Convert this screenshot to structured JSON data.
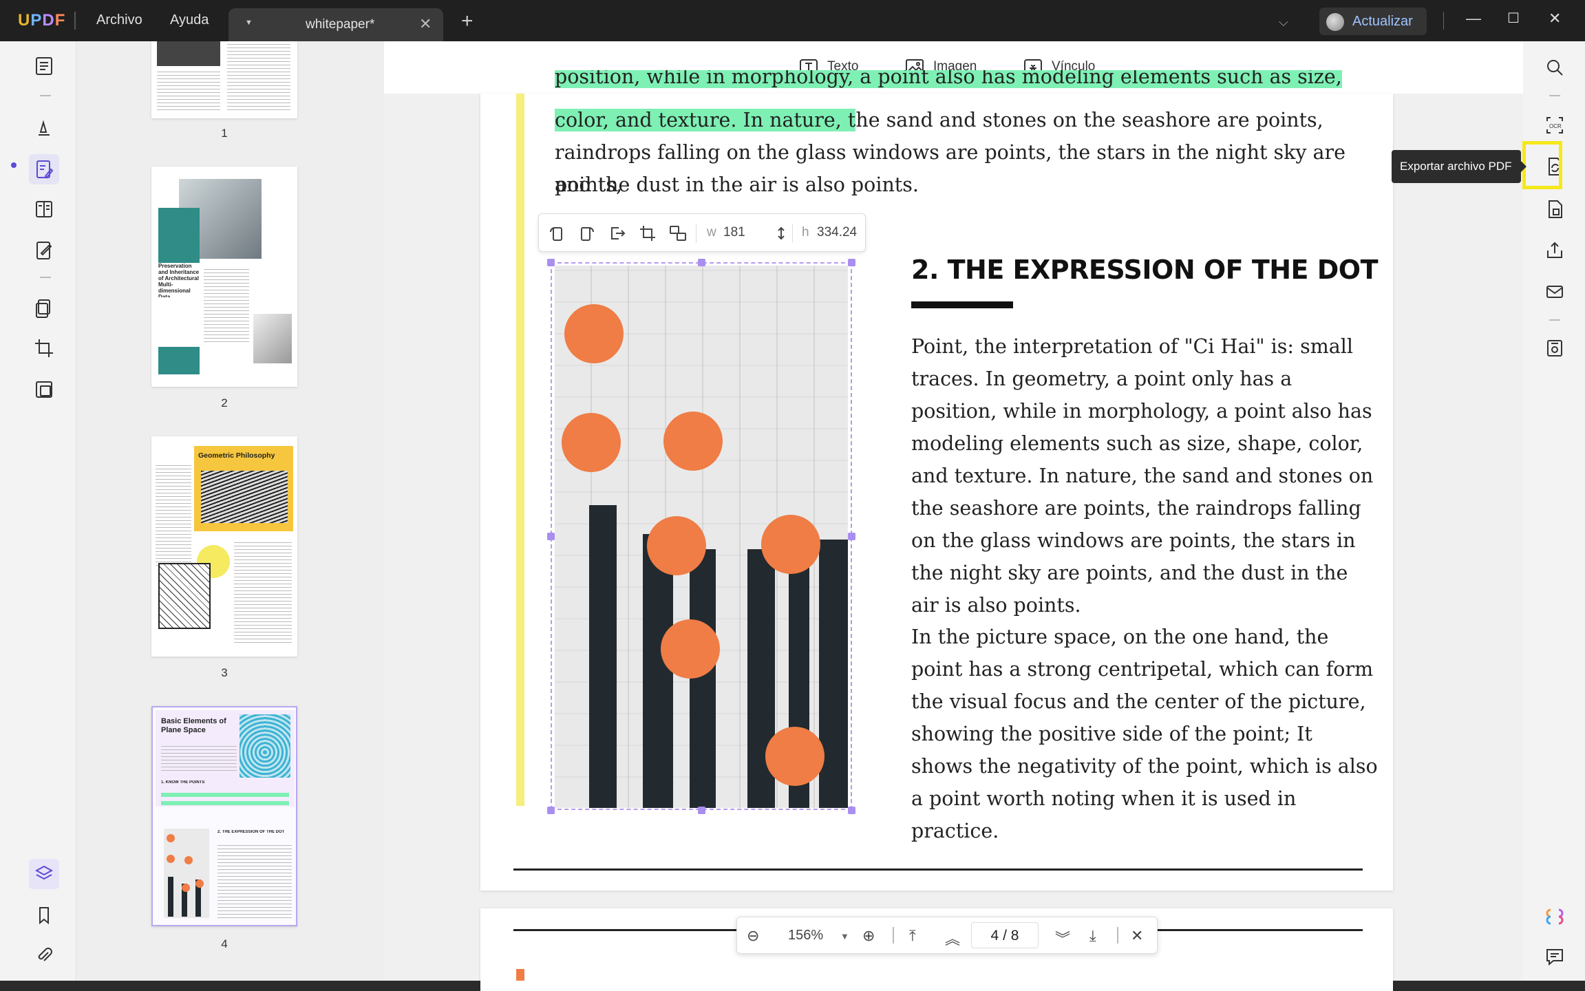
{
  "titlebar": {
    "logo": [
      "U",
      "P",
      "D",
      "F"
    ],
    "menu": [
      "Archivo",
      "Ayuda"
    ],
    "tab_name": "whitepaper*",
    "update_label": "Actualizar"
  },
  "toolbar": {
    "text_label": "Texto",
    "image_label": "Imagen",
    "link_label": "Vínculo"
  },
  "thumbs": {
    "pages": [
      "1",
      "2",
      "3",
      "4"
    ],
    "p2_title": "Preservation and Inheritance of Architectural Multi-dimensional Data",
    "p3_title": "Geometric Philosophy",
    "p4_title": "Basic Elements of Plane Space",
    "p4_sub1": "1. KNOW THE POINTS",
    "p4_sub2": "2. THE EXPRESSION OF THE DOT"
  },
  "document": {
    "top_lines": [
      "position, while in morphology, a point also has modeling elements such as size, shape,",
      "color, and texture. In nature, t",
      "he sand and stones on the seashore are points, the",
      "raindrops falling on the glass windows are points, the stars in the night sky are points,",
      "and the dust in the air is also points."
    ],
    "heading": "2. THE EXPRESSION OF THE DOT",
    "para1": "Point, the interpretation of \"Ci Hai\" is: small traces. In geometry, a point only has a position, while in morphology, a point also has modeling elements such as size, shape, color, and texture. In nature, the sand and stones on the seashore are points, the raindrops falling on the glass windows are points, the stars in the night sky are points, and the dust in the air is also points.",
    "para2": "In the picture space, on the one hand, the point has a strong centripetal, which can form the visual focus and the center of the picture, showing the positive side of the point; It shows the negativity of the point, which is also a point worth noting when it is used in practice."
  },
  "image_toolbar": {
    "w_label": "w",
    "w_value": "181",
    "h_label": "h",
    "h_value": "334.24"
  },
  "rightrail": {
    "tooltip": "Exportar archivo PDF"
  },
  "bottombar": {
    "zoom": "156%",
    "page_current": "4",
    "page_sep": "/",
    "page_total": "8"
  },
  "colors": {
    "highlight": "#7ef0b4",
    "accent_yellow": "#f5e81b",
    "selection": "#a98ef0",
    "dot_orange": "#ef7d45"
  }
}
